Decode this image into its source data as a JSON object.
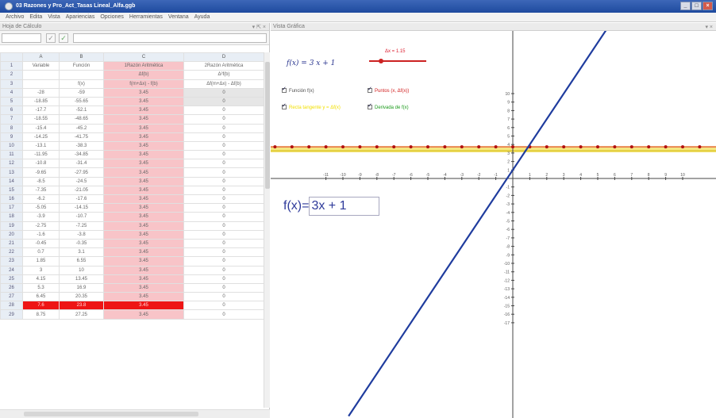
{
  "window": {
    "title": "03 Razones y Pro_Act_Tasas Lineal_Alfa.ggb"
  },
  "menu": [
    "Archivo",
    "Edita",
    "Vista",
    "Apariencias",
    "Opciones",
    "Herramientas",
    "Ventana",
    "Ayuda"
  ],
  "spreadsheet": {
    "panel_title": "Hoja de Cálculo",
    "columns": [
      "A",
      "B",
      "C",
      "D"
    ],
    "header_rows": [
      [
        "Variable",
        "Función",
        "1Razón Aritmética",
        "2Razón Aritmética"
      ],
      [
        "",
        "",
        "Δf(b)",
        "Δ²f(b)"
      ],
      [
        "",
        "f(x)",
        "f(m+Δx) - f(b)",
        "Δf(m+Δx) - Δf(b)"
      ]
    ],
    "rows": [
      [
        "-28",
        "-59",
        "3.45",
        "0"
      ],
      [
        "-18.85",
        "-55.65",
        "3.45",
        "0"
      ],
      [
        "-17.7",
        "-52.1",
        "3.45",
        "0"
      ],
      [
        "-18.55",
        "-48.65",
        "3.45",
        "0"
      ],
      [
        "-15.4",
        "-45.2",
        "3.45",
        "0"
      ],
      [
        "-14.25",
        "-41.75",
        "3.45",
        "0"
      ],
      [
        "-13.1",
        "-38.3",
        "3.45",
        "0"
      ],
      [
        "-11.95",
        "-34.85",
        "3.45",
        "0"
      ],
      [
        "-10.8",
        "-31.4",
        "3.45",
        "0"
      ],
      [
        "-9.65",
        "-27.95",
        "3.45",
        "0"
      ],
      [
        "-8.5",
        "-24.5",
        "3.45",
        "0"
      ],
      [
        "-7.35",
        "-21.05",
        "3.45",
        "0"
      ],
      [
        "-6.2",
        "-17.6",
        "3.45",
        "0"
      ],
      [
        "-5.05",
        "-14.15",
        "3.45",
        "0"
      ],
      [
        "-3.9",
        "-10.7",
        "3.45",
        "0"
      ],
      [
        "-2.75",
        "-7.25",
        "3.45",
        "0"
      ],
      [
        "-1.6",
        "-3.8",
        "3.45",
        "0"
      ],
      [
        "-0.45",
        "-0.35",
        "3.45",
        "0"
      ],
      [
        "0.7",
        "3.1",
        "3.45",
        "0"
      ],
      [
        "1.85",
        "6.55",
        "3.45",
        "0"
      ],
      [
        "3",
        "10",
        "3.45",
        "0"
      ],
      [
        "4.15",
        "13.45",
        "3.45",
        "0"
      ],
      [
        "5.3",
        "16.9",
        "3.45",
        "0"
      ],
      [
        "6.45",
        "20.35",
        "3.45",
        "0"
      ],
      [
        "7.6",
        "23.8",
        "3.45",
        "0"
      ],
      [
        "8.75",
        "27.25",
        "3.45",
        "0"
      ]
    ],
    "highlight_row": 24
  },
  "graphics": {
    "panel_title": "Vista Gráfica",
    "formula": "f(x) = 3 x + 1",
    "slider_label": "Δx = 1.15",
    "checkboxes": [
      {
        "label": "Función f(x)",
        "color": "#404040"
      },
      {
        "label": "Puntos (x, Δf(x))",
        "color": "#d22020"
      },
      {
        "label": "Recta tangente y = Δf(x)",
        "color": "#f2e000"
      },
      {
        "label": "Derivada de f(x)",
        "color": "#1a9a1a"
      }
    ],
    "input_label": "f(x)=",
    "input_value": "3x + 1",
    "colors": {
      "line": "#1f3c9e",
      "points": "#b01010",
      "band": "#f2e26a",
      "redline": "#e03030"
    },
    "function": {
      "slope": 3,
      "intercept": 1
    },
    "x_ticks": [
      -11,
      -10,
      -9,
      -8,
      -7,
      -6,
      -5,
      -4,
      -3,
      -2,
      -1,
      1,
      2,
      3,
      4,
      5,
      6,
      7,
      8,
      9,
      10
    ],
    "y_ticks": [
      10,
      9,
      8,
      7,
      6,
      5,
      4,
      3,
      2,
      1,
      -1,
      -2,
      -3,
      -4,
      -5,
      -6,
      -7,
      -8,
      -9,
      -10,
      -11,
      -12,
      -13,
      -14,
      -15,
      -16,
      -17
    ],
    "points_y": 3.45
  }
}
